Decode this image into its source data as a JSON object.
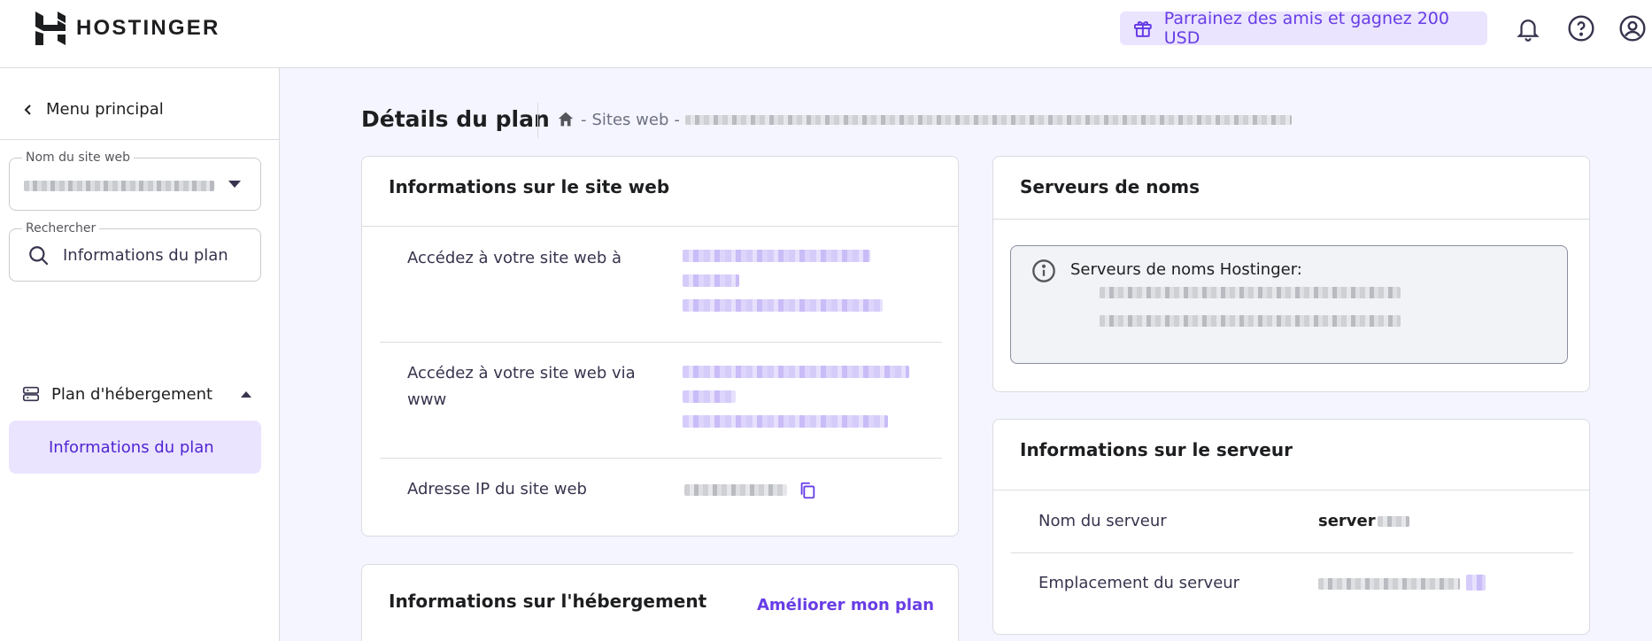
{
  "brand": {
    "name": "HOSTINGER"
  },
  "header": {
    "referral_label": "Parrainez des amis et gagnez 200 USD",
    "icons": [
      "gift-icon",
      "bell-icon",
      "help-icon",
      "account-icon"
    ]
  },
  "sidebar": {
    "back_label": "Menu principal",
    "website_field": {
      "label": "Nom du site web"
    },
    "search_field": {
      "label": "Rechercher",
      "value": "Informations du plan"
    },
    "section": {
      "label": "Plan d'hébergement"
    },
    "active_item": "Informations du plan"
  },
  "main": {
    "page_title": "Détails du plan",
    "breadcrumb": {
      "sites": "Sites web"
    },
    "website_card": {
      "title": "Informations sur le site web",
      "rows": [
        {
          "label": "Accédez à votre site web à"
        },
        {
          "label": "Accédez à votre site web via www"
        },
        {
          "label": "Adresse IP du site web"
        }
      ]
    },
    "hosting_card": {
      "title": "Informations sur l'hébergement",
      "upgrade_label": "Améliorer mon plan"
    },
    "nameservers_card": {
      "title": "Serveurs de noms",
      "heading": "Serveurs de noms Hostinger:"
    },
    "server_card": {
      "title": "Informations sur le serveur",
      "rows": [
        {
          "label": "Nom du serveur",
          "value": "server"
        },
        {
          "label": "Emplacement du serveur"
        }
      ]
    }
  },
  "colors": {
    "accent": "#673de6",
    "accent_bg": "#ebe4ff",
    "page_bg": "#f4f5ff"
  }
}
